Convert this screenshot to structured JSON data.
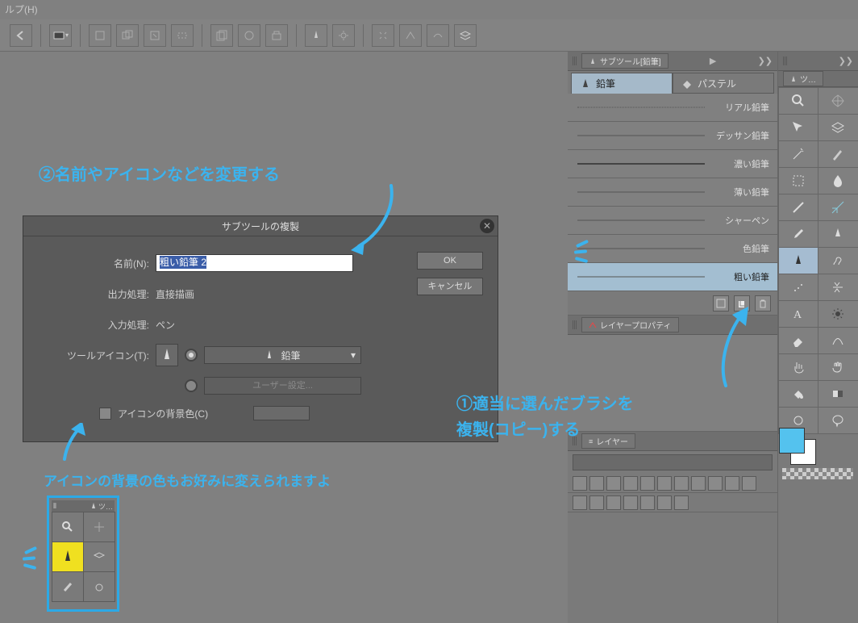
{
  "menu": {
    "help": "ルプ(H)"
  },
  "annotations": {
    "step2": "②名前やアイコンなどを変更する",
    "step1a": "①適当に選んだブラシを",
    "step1b": "複製(コピー)する",
    "tip": "アイコンの背景の色もお好みに変えられますよ"
  },
  "dialog": {
    "title": "サブツールの複製",
    "name_label": "名前(N):",
    "name_value": "粗い鉛筆 2",
    "output_label": "出力処理:",
    "output_value": "直接描画",
    "input_label": "入力処理:",
    "input_value": "ペン",
    "toolicon_label": "ツールアイコン(T):",
    "toolicon_value": "鉛筆",
    "usersetting": "ユーザー設定...",
    "iconbg_label": "アイコンの背景色(C)",
    "ok": "OK",
    "cancel": "キャンセル"
  },
  "panels": {
    "subtool_tab": "サブツール[鉛筆]",
    "tools_tab": "ツ…",
    "layerprop": "レイヤープロパティ",
    "layers": "レイヤー",
    "tab_pencil": "鉛筆",
    "tab_pastel": "パステル"
  },
  "brushes": [
    {
      "name": "リアル鉛筆"
    },
    {
      "name": "デッサン鉛筆"
    },
    {
      "name": "濃い鉛筆"
    },
    {
      "name": "薄い鉛筆"
    },
    {
      "name": "シャーペン"
    },
    {
      "name": "色鉛筆"
    },
    {
      "name": "粗い鉛筆"
    }
  ],
  "mini_label": "ツ…",
  "colors": {
    "annotation": "#3bb3ee",
    "fg": "#54c2ee",
    "bg": "#ffffff"
  }
}
